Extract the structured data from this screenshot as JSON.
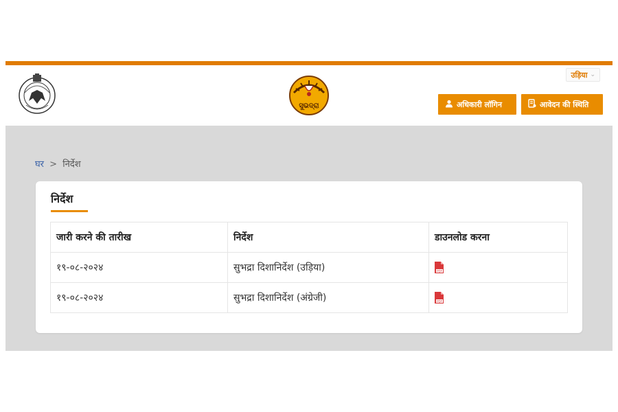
{
  "header": {
    "language_select": "उड़िया",
    "login_button": "अधिकारी लॉगिन",
    "status_button": "आवेदन की स्थिति",
    "logo_text": "ସୁଭଦ୍ରା",
    "emblem_top_text": "ଓଡ଼ିଶା ସରକାର"
  },
  "breadcrumb": {
    "home": "घर",
    "separator": ">",
    "current": "निर्देश"
  },
  "card": {
    "title": "निर्देश",
    "columns": [
      "जारी करने की तारीख",
      "निर्देश",
      "डाउनलोड करना"
    ],
    "rows": [
      {
        "date": "१९-०८-२०२४",
        "title": "सुभद्रा दिशानिर्देश (उड़िया)",
        "download_icon": "pdf-icon"
      },
      {
        "date": "१९-०८-२०२४",
        "title": "सुभद्रा दिशानिर्देश (अंग्रेजी)",
        "download_icon": "pdf-icon"
      }
    ]
  },
  "colors": {
    "accent": "#e98c00",
    "top_bar": "#e07b00",
    "link": "#3a62a8",
    "pdf": "#d9383a",
    "page_bg": "#d9d9d9"
  }
}
